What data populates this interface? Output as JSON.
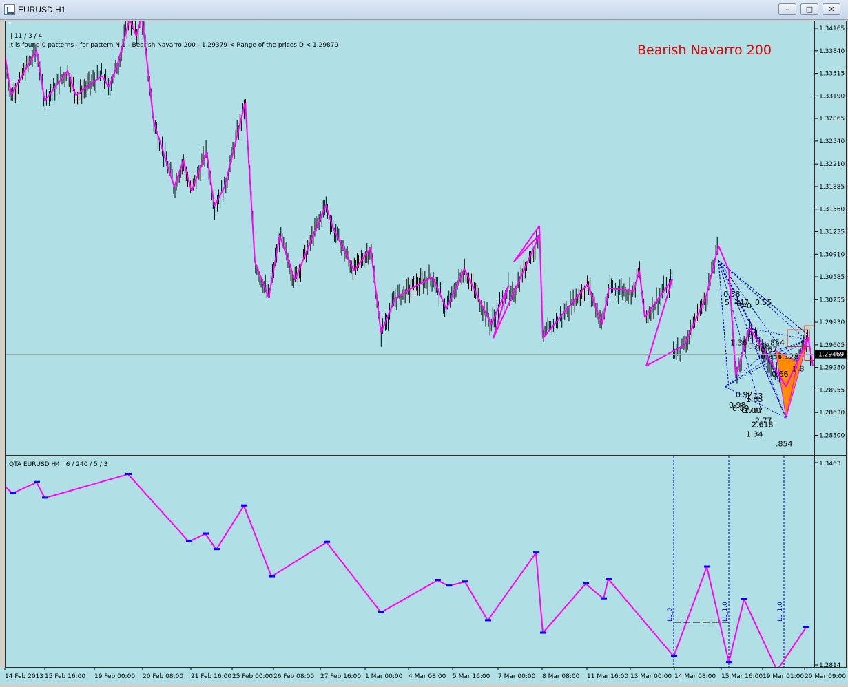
{
  "window": {
    "title": "EURUSD,H1",
    "minimize_label": "–",
    "maximize_label": "□",
    "close_label": "✕"
  },
  "main_panel": {
    "indicator_params": "| 11 / 3 / 4",
    "status_text": "It is found 0 patterns  -  for pattern N 1 - Bearish Navarro 200   - 1.29379 < Range of the prices D < 1.29879",
    "pattern_label": "Bearish Navarro 200",
    "pattern_label_color": "#e60000",
    "current_price": "1.29469",
    "price_ticks": [
      "1.34165",
      "1.33840",
      "1.33515",
      "1.33190",
      "1.32865",
      "1.32540",
      "1.32210",
      "1.31885",
      "1.31560",
      "1.31235",
      "1.30910",
      "1.30585",
      "1.30255",
      "1.29930",
      "1.29605",
      "1.29280",
      "1.28955",
      "1.28630",
      "1.28300"
    ],
    "ratio_labels": [
      "0.58",
      "5",
      "447",
      "640",
      "0.55",
      "1.36",
      "0.618",
      "0.67",
      "854",
      "1.128",
      "0.854",
      "1.8",
      "0.66",
      "0.92",
      "1.13",
      "0.98",
      "1.05",
      "0.89",
      "0.707",
      "1.00",
      "2.77",
      "2.618",
      "1.34",
      ".854"
    ]
  },
  "sub_panel": {
    "header": "QTA EURUSD H4 | 6 / 240 / 5 / 3",
    "scale_top": "1.3463",
    "scale_bottom": "1.2814",
    "vertical_markers": [
      "LL_0",
      "LL_1.0",
      "LL_1.0"
    ]
  },
  "time_axis": {
    "labels": [
      "14 Feb 2013",
      "15 Feb 16:00",
      "19 Feb 00:00",
      "20 Feb 08:00",
      "21 Feb 16:00",
      "25 Feb 00:00",
      "26 Feb 08:00",
      "27 Feb 16:00",
      "1 Mar 00:00",
      "4 Mar 08:00",
      "5 Mar 16:00",
      "7 Mar 00:00",
      "8 Mar 08:00",
      "11 Mar 16:00",
      "13 Mar 00:00",
      "14 Mar 08:00",
      "15 Mar 16:00",
      "19 Mar 01:00",
      "20 Mar 09:00"
    ]
  },
  "colors": {
    "background": "#b0e0e6",
    "bars": "#000000",
    "zigzag": "#ff00ff",
    "pattern_fill": "#ff8c00",
    "dashed_lines": "#0000cd",
    "pivot_markers": "#0000ff"
  },
  "chart_data": [
    {
      "type": "line",
      "title": "EURUSD,H1",
      "ylim": [
        1.283,
        1.3445
      ],
      "grid": false,
      "series": [
        {
          "name": "",
          "x": [
            "14 Feb 2013",
            "14 Feb 2013",
            "15 Feb 2013",
            "15 Feb 2013",
            "15 Feb 16:00",
            "15 Feb 16:00",
            "18 Feb 2013",
            "18 Feb 2013",
            "19 Feb 00:00",
            "19 Feb 2013",
            "19 Feb 2013",
            "20 Feb 08:00",
            "20 Feb 08:00",
            "21 Feb 2013",
            "21 Feb 2013",
            "21 Feb 16:00",
            "21 Feb 16:00",
            "22 Feb 2013",
            "22 Feb 2013",
            "25 Feb 00:00",
            "25 Feb 2013",
            "26 Feb 2013",
            "26 Feb 08:00",
            "27 Feb 2013",
            "27 Feb 16:00",
            "27 Feb 16:00",
            "28 Feb 2013",
            "1 Mar 00:00",
            "1 Mar 00:00",
            "4 Mar 2013",
            "4 Mar 08:00",
            "4 Mar 08:00",
            "5 Mar 2013",
            "5 Mar 16:00",
            "6 Mar 2013",
            "7 Mar 00:00",
            "7 Mar 2013",
            "8 Mar 2013",
            "8 Mar 08:00",
            "8 Mar 08:00",
            "11 Mar 2013",
            "11 Mar 16:00",
            "11 Mar 16:00",
            "12 Mar 2013",
            "12 Mar 2013",
            "13 Mar 00:00",
            "13 Mar 00:00",
            "13 Mar 2013",
            "13 Mar 2013",
            "14 Mar 08:00",
            "14 Mar 08:00",
            "15 Mar 2013",
            "15 Mar 16:00",
            "18 Mar 2013",
            "19 Mar 01:00",
            "19 Mar 2013",
            "20 Mar 2013",
            "20 Mar 09:00"
          ],
          "y": [
            1.3372,
            1.332,
            1.3385,
            1.3312,
            1.3355,
            1.332,
            1.3348,
            1.3332,
            1.3362,
            1.343,
            1.3405,
            1.3435,
            1.3282,
            1.3188,
            1.3226,
            1.3182,
            1.3238,
            1.316,
            1.3188,
            1.331,
            1.308,
            1.3028,
            1.3118,
            1.3054,
            1.3162,
            1.313,
            1.3067,
            1.31,
            1.2978,
            1.3028,
            1.304,
            1.3058,
            1.3012,
            1.307,
            1.299,
            1.3045,
            1.297,
            1.312,
            1.308,
            1.3132,
            1.297,
            1.3048,
            1.299,
            1.3042,
            1.3038,
            1.3068,
            1.3,
            1.3055,
            1.293,
            1.296,
            1.303,
            1.3103,
            1.3068,
            1.2915,
            1.2985,
            1.29,
            1.2972,
            1.293
          ]
        }
      ]
    },
    {
      "type": "line",
      "title": "QTA EURUSD H4 | 6 / 240 / 5 / 3",
      "ylim": [
        1.2814,
        1.3463
      ],
      "series": [
        {
          "name": "",
          "x": [
            "14 Feb 2013",
            "14 Feb 2013",
            "15 Feb 2013",
            "15 Feb 2013",
            "19 Feb 00:00",
            "21 Feb 16:00",
            "21 Feb 16:00",
            "21 Feb 16:00",
            "25 Feb 00:00",
            "26 Feb 08:00",
            "27 Feb 16:00",
            "1 Mar 00:00",
            "4 Mar 08:00",
            "5 Mar 16:00",
            "5 Mar 16:00",
            "7 Mar 00:00",
            "8 Mar 08:00",
            "8 Mar 08:00",
            "11 Mar 16:00",
            "11 Mar 16:00",
            "11 Mar 16:00",
            "14 Mar 08:00",
            "15 Mar 16:00",
            "15 Mar 16:00",
            "15 Mar 16:00",
            "19 Mar 01:00",
            "20 Mar 09:00"
          ],
          "y": [
            1.34,
            1.338,
            1.3415,
            1.3365,
            1.3441,
            1.3225,
            1.325,
            1.32,
            1.334,
            1.3113,
            1.3223,
            1.2998,
            1.3101,
            1.3083,
            1.3096,
            1.2972,
            1.3189,
            1.2932,
            1.309,
            1.3042,
            1.3105,
            1.2857,
            1.3144,
            1.2838,
            1.304,
            1.2812,
            1.295
          ]
        }
      ]
    }
  ]
}
